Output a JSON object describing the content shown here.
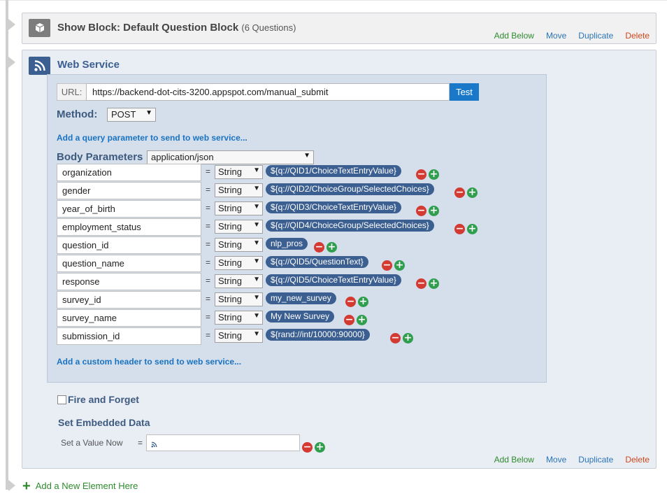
{
  "block1": {
    "title": "Show Block: Default Question Block",
    "subtitle": "(6 Questions)",
    "icon": "cube-icon",
    "actions": {
      "add_below": "Add Below",
      "move": "Move",
      "duplicate": "Duplicate",
      "delete": "Delete"
    }
  },
  "block2": {
    "title": "Web Service",
    "icon": "rss-icon",
    "url": {
      "label": "URL:",
      "value": "https://backend-dot-cits-3200.appspot.com/manual_submit",
      "test_label": "Test"
    },
    "method": {
      "label": "Method:",
      "value": "POST"
    },
    "add_query_link": "Add a query parameter to send to web service...",
    "body": {
      "label": "Body Parameters",
      "content_type": "application/json"
    },
    "params": [
      {
        "name": "organization",
        "type": "String",
        "value": "${q://QID1/ChoiceTextEntryValue}"
      },
      {
        "name": "gender",
        "type": "String",
        "value": "${q://QID2/ChoiceGroup/SelectedChoices}"
      },
      {
        "name": "year_of_birth",
        "type": "String",
        "value": "${q://QID3/ChoiceTextEntryValue}"
      },
      {
        "name": "employment_status",
        "type": "String",
        "value": "${q://QID4/ChoiceGroup/SelectedChoices}"
      },
      {
        "name": "question_id",
        "type": "String",
        "value": "nlp_pros"
      },
      {
        "name": "question_name",
        "type": "String",
        "value": "${q://QID5/QuestionText}"
      },
      {
        "name": "response",
        "type": "String",
        "value": "${q://QID5/ChoiceTextEntryValue}"
      },
      {
        "name": "survey_id",
        "type": "String",
        "value": "my_new_survey"
      },
      {
        "name": "survey_name",
        "type": "String",
        "value": "My New Survey"
      },
      {
        "name": "submission_id",
        "type": "String",
        "value": "${rand://int/10000:90000}"
      }
    ],
    "add_header_link": "Add a custom header to send to web service...",
    "fire_and_forget": "Fire and Forget",
    "set_embedded": {
      "title": "Set Embedded Data",
      "label": "Set a Value Now",
      "eq": "="
    },
    "actions": {
      "add_below": "Add Below",
      "move": "Move",
      "duplicate": "Duplicate",
      "delete": "Delete"
    }
  },
  "eq_symbol": "=",
  "add_new_element": "Add a New Element Here",
  "colors": {
    "accent": "#3c5f91",
    "add": "#2e8b2e",
    "link": "#2a73b6",
    "delete": "#d0451b",
    "minus": "#d33a32",
    "plus": "#2f9e4d"
  }
}
